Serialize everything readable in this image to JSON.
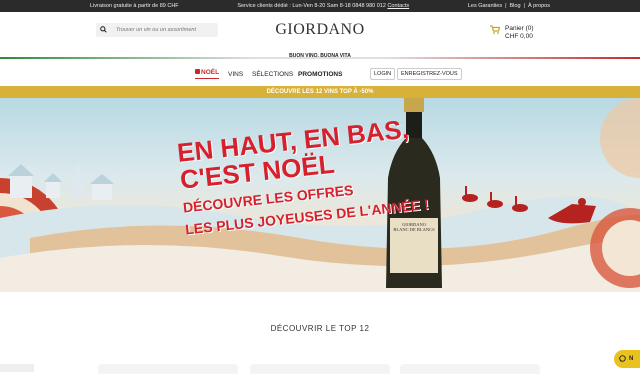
{
  "topbar": {
    "left": "Livraison gratuite à partir de 89 CHF",
    "middle": "Service clients dédié : Lun-Ven 8-20 Sam 8-18 0848 980 012",
    "contact_link": "Contacts",
    "links": [
      "Les Garanties",
      "|",
      "Blog",
      "|",
      "À propos"
    ]
  },
  "header": {
    "search_placeholder": "Trouver un vin ou un assortiment",
    "logo": "GIORDANO",
    "tagline": "BUON VINO, BUONA VITA",
    "cart_label": "Panier (0)",
    "cart_total": "CHF 0,00"
  },
  "nav": {
    "items": [
      "NOËL",
      "VINS",
      "SÉLECTIONS",
      "PROMOTIONS"
    ],
    "login": "LOGIN",
    "register": "ENREGISTREZ-VOUS"
  },
  "promo": "DÉCOUVRE LES 12 VINS TOP À -50%",
  "hero": {
    "line1": "EN HAUT, EN BAS,",
    "line2": "C'EST NOËL",
    "line3": "DÉCOUVRE LES OFFRES",
    "line4": "LES PLUS JOYEUSES DE L'ANNÉE !",
    "bottle_label": "GIORDANO",
    "bottle_sub": "BLANC DE BLANCS"
  },
  "section_title": "DÉCOUVRIR LE TOP 12",
  "chat_label": "N"
}
